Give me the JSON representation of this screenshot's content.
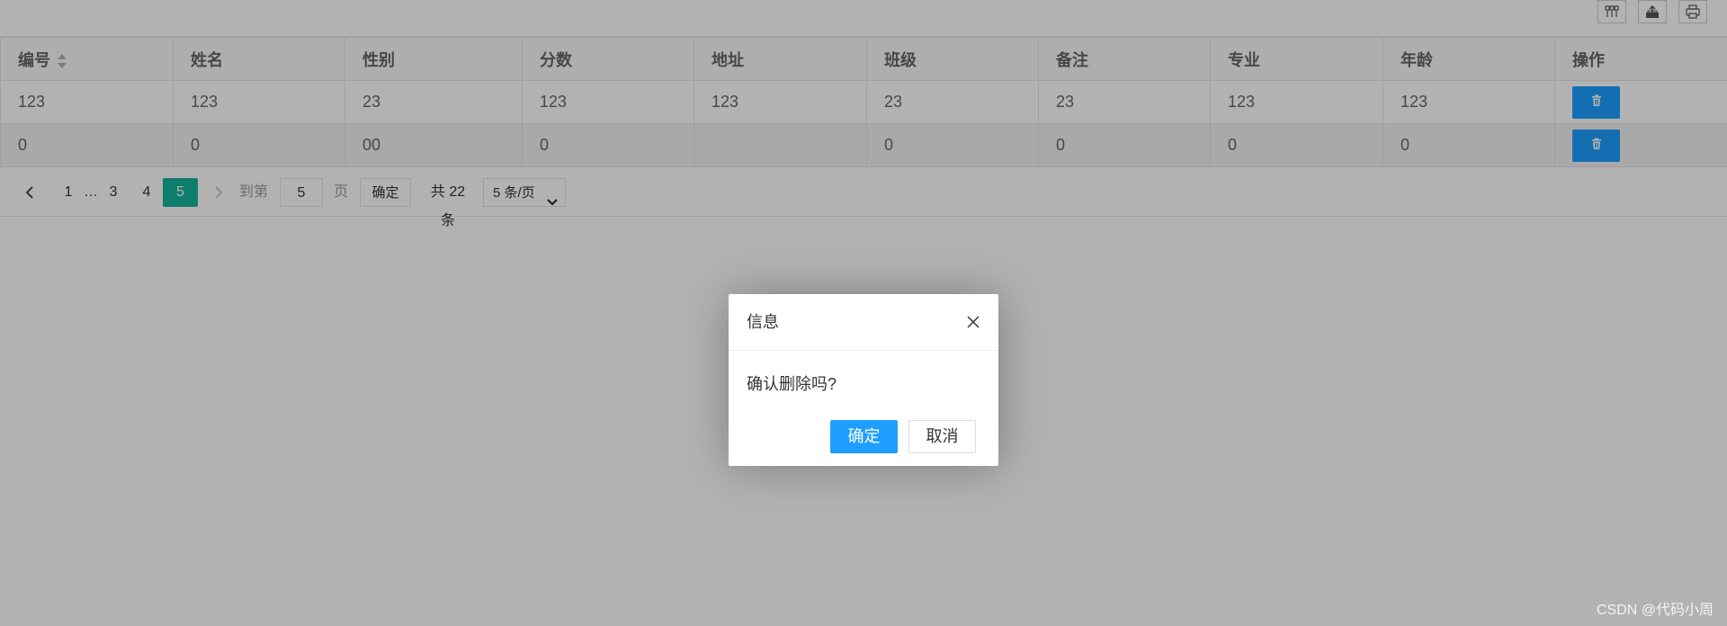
{
  "toolbar": {
    "icons": [
      "columns-filter-icon",
      "export-icon",
      "print-icon"
    ]
  },
  "table": {
    "headers": [
      "编号",
      "姓名",
      "性别",
      "分数",
      "地址",
      "班级",
      "备注",
      "专业",
      "年龄",
      "操作"
    ],
    "rows": [
      [
        "123",
        "123",
        "23",
        "123",
        "123",
        "23",
        "23",
        "123",
        "123"
      ],
      [
        "0",
        "0",
        "00",
        "0",
        "",
        "0",
        "0",
        "0",
        "0"
      ]
    ],
    "delete_icon": "trash-icon"
  },
  "pagination": {
    "prev_icon": "chevron-left-icon",
    "pages": [
      "1",
      "…",
      "3",
      "4"
    ],
    "current": "5",
    "next_icon": "chevron-right-icon",
    "goto_label": "到第",
    "goto_value": "5",
    "page_unit": "页",
    "confirm_label": "确定",
    "total_label": "共 22 条",
    "page_size": "5 条/页"
  },
  "dialog": {
    "title": "信息",
    "message": "确认删除吗?",
    "ok_label": "确定",
    "cancel_label": "取消"
  },
  "watermark": "CSDN @代码小周",
  "colors": {
    "primary": "#1e9fff",
    "page_active": "#16b39b",
    "shade": "rgba(0,0,0,0.3)"
  }
}
